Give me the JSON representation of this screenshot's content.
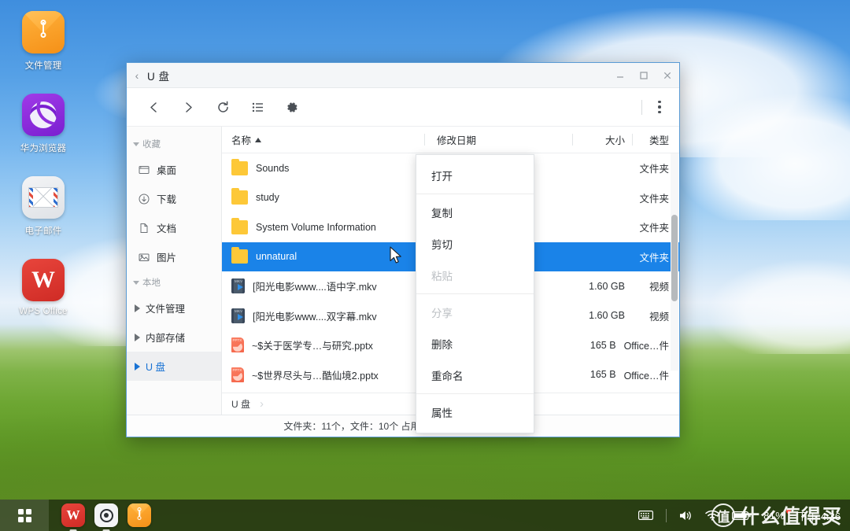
{
  "desktop": {
    "icons": [
      {
        "label": "文件管理",
        "icon": "file-manager-icon"
      },
      {
        "label": "华为浏览器",
        "icon": "huawei-browser-icon"
      },
      {
        "label": "电子邮件",
        "icon": "email-icon"
      },
      {
        "label": "WPS Office",
        "icon": "wps-office-icon"
      }
    ]
  },
  "window": {
    "title": "U 盘",
    "back_chevron": "‹",
    "controls": {
      "minimize": "minimize-icon",
      "maximize": "maximize-icon",
      "close": "close-icon"
    },
    "toolbar": {
      "back": "back-icon",
      "forward": "forward-icon",
      "refresh": "refresh-icon",
      "view_list": "list-view-icon",
      "settings": "gear-icon",
      "more": "more-vertical-icon"
    }
  },
  "sidebar": {
    "groups": [
      {
        "label": "收藏",
        "items": [
          {
            "label": "桌面",
            "icon": "desktop-icon"
          },
          {
            "label": "下载",
            "icon": "download-icon"
          },
          {
            "label": "文档",
            "icon": "document-icon"
          },
          {
            "label": "图片",
            "icon": "picture-icon"
          }
        ]
      },
      {
        "label": "本地",
        "items": [
          {
            "label": "文件管理",
            "icon": "expand-triangle-icon",
            "active": false
          },
          {
            "label": "内部存储",
            "icon": "expand-triangle-icon",
            "active": false
          },
          {
            "label": "U 盘",
            "icon": "expand-triangle-icon",
            "active": true
          }
        ]
      }
    ]
  },
  "columns": {
    "name": "名称",
    "sort_indicator": "▲",
    "date": "修改日期",
    "size": "大小",
    "type": "类型"
  },
  "files": [
    {
      "name": "Sounds",
      "icon": "folder-icon",
      "date": "",
      "size": "",
      "type": "文件夹",
      "selected": false
    },
    {
      "name": "study",
      "icon": "folder-icon",
      "date": "",
      "size": "",
      "type": "文件夹",
      "selected": false
    },
    {
      "name": "System Volume Information",
      "icon": "folder-icon",
      "date": "",
      "size": "",
      "type": "文件夹",
      "selected": false
    },
    {
      "name": "unnatural",
      "icon": "folder-icon",
      "date": "",
      "size": "",
      "type": "文件夹",
      "selected": true
    },
    {
      "name": "[阳光电影www....语中字.mkv",
      "icon": "mkv-icon",
      "date": "",
      "size": "1.60 GB",
      "type": "视频",
      "selected": false
    },
    {
      "name": "[阳光电影www....双字幕.mkv",
      "icon": "mkv-icon",
      "date": "",
      "size": "1.60 GB",
      "type": "视频",
      "selected": false
    },
    {
      "name": "~$关于医学专…与研究.pptx",
      "icon": "pptx-icon",
      "date": "",
      "size": "165 B",
      "type": "Office…件",
      "selected": false
    },
    {
      "name": "~$世界尽头与…酷仙境2.pptx",
      "icon": "pptx-icon",
      "date": "",
      "size": "165 B",
      "type": "Office…件",
      "selected": false
    }
  ],
  "breadcrumb": {
    "path": "U 盘",
    "separator": "›"
  },
  "statusbar": {
    "text": "文件夹：11个，文件：10个 占用…… GB（已选中 1 个）"
  },
  "context_menu": {
    "items": [
      {
        "label": "打开",
        "disabled": false,
        "sep_after": true
      },
      {
        "label": "复制",
        "disabled": false,
        "sep_after": false
      },
      {
        "label": "剪切",
        "disabled": false,
        "sep_after": false
      },
      {
        "label": "粘贴",
        "disabled": true,
        "sep_after": true
      },
      {
        "label": "分享",
        "disabled": true,
        "sep_after": false
      },
      {
        "label": "删除",
        "disabled": false,
        "sep_after": false
      },
      {
        "label": "重命名",
        "disabled": false,
        "sep_after": true
      },
      {
        "label": "属性",
        "disabled": false,
        "sep_after": false
      }
    ]
  },
  "taskbar": {
    "apps_button": "apps-grid-icon",
    "running": [
      {
        "name": "WPS Office",
        "icon": "wps-office-icon",
        "active": false
      },
      {
        "name": "华为浏览器",
        "icon": "huawei-browser-icon",
        "active": false
      },
      {
        "name": "文件管理",
        "icon": "file-manager-icon",
        "active": true
      }
    ],
    "tray": {
      "keyboard": "keyboard-icon",
      "volume": "volume-icon",
      "wifi": "wifi-icon",
      "battery": "battery-icon",
      "battery_percent": "81%",
      "time": "下午 4:36"
    }
  },
  "watermark": {
    "logo": "值",
    "text": "什么值得买"
  },
  "colors": {
    "accent_blue": "#1a83e8",
    "sidebar_active_text": "#1a73d4",
    "folder_yellow": "#fdc838",
    "battery_alert": "#ff3b30",
    "taskbar_bg": "rgba(30,42,16,.80)"
  }
}
